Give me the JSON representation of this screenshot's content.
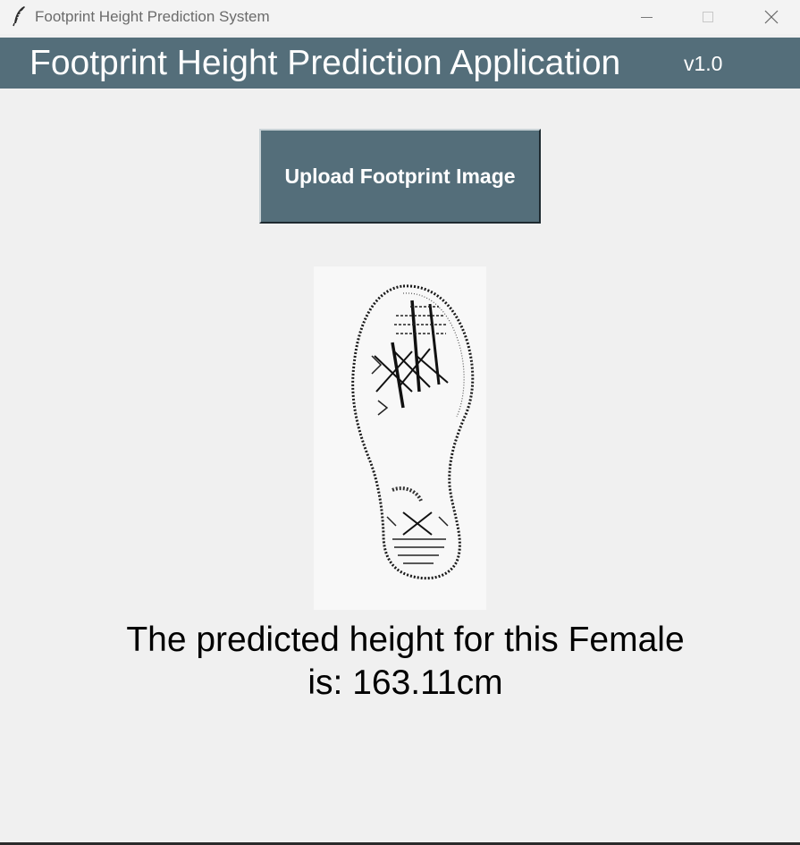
{
  "window": {
    "title": "Footprint Height Prediction System",
    "icon": "feather-icon"
  },
  "header": {
    "title": "Footprint Height Prediction Application",
    "version": "v1.0",
    "background": "#546e7a"
  },
  "upload": {
    "label": "Upload Footprint Image"
  },
  "result": {
    "line1": "The predicted height for this Female",
    "line2": "is: 163.11cm"
  }
}
